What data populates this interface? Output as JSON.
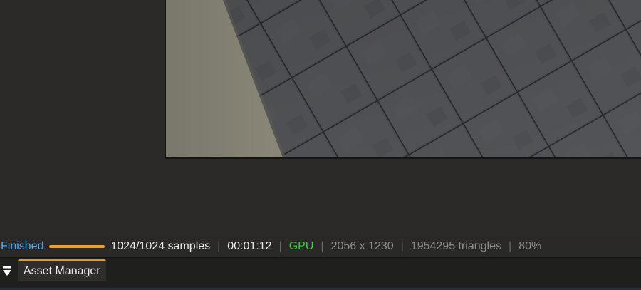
{
  "status_bar": {
    "state": "Finished",
    "progress_fraction": 1.0,
    "samples": "1024/1024 samples",
    "time": "00:01:12",
    "device": "GPU",
    "resolution": "2056 x 1230",
    "triangles": "1954295 triangles",
    "zoom": "80%",
    "separator": "|",
    "colors": {
      "state": "#58a7e6",
      "progress": "#f0a030",
      "device": "#46c64b"
    }
  },
  "panel_tabs": {
    "toggle_icon": "triangle-down-menu-icon",
    "active_tab": "Asset Manager",
    "accent": "#e8951c"
  }
}
